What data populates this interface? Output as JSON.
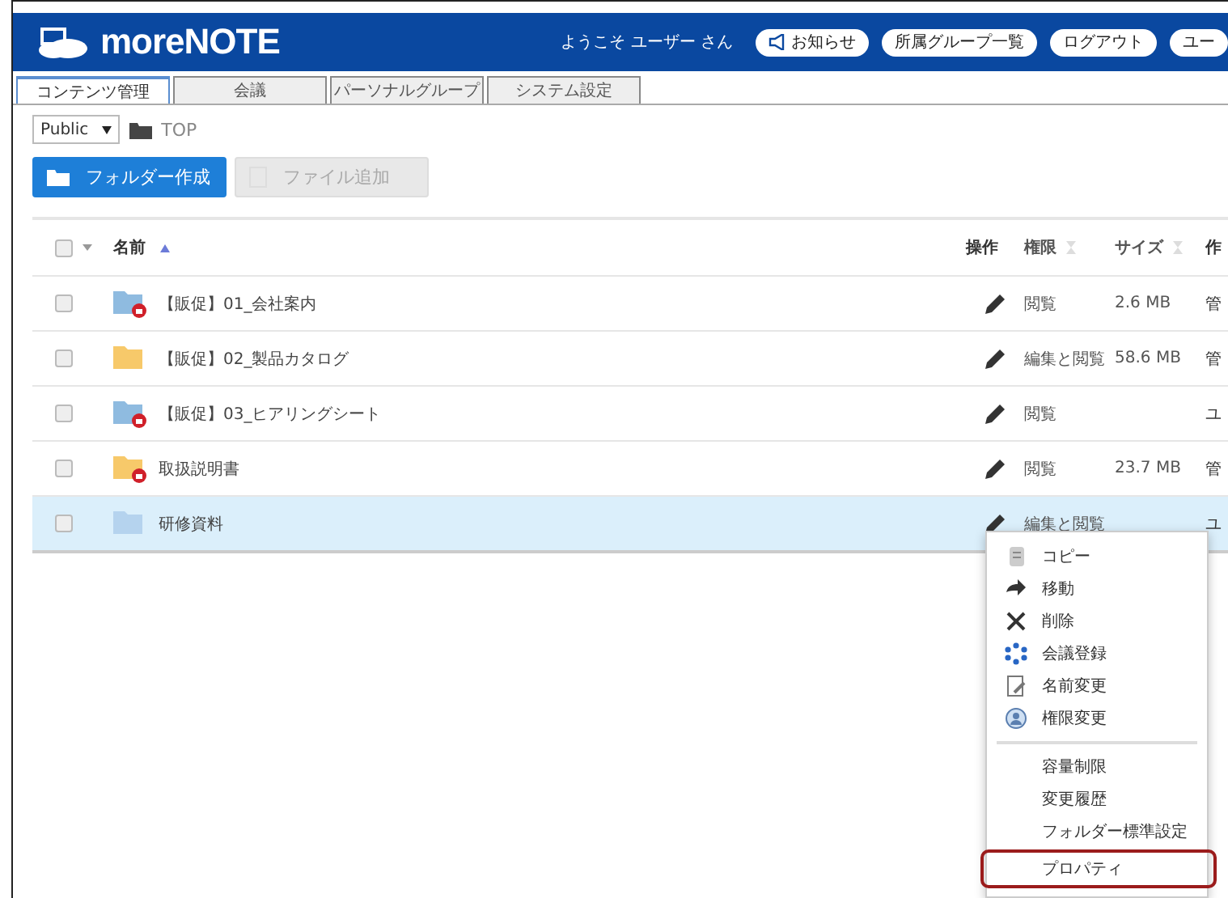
{
  "header": {
    "logo": "moreNOTE",
    "welcome": "ようこそ ユーザー さん",
    "buttons": [
      {
        "label": "お知らせ",
        "kind": "megaphone"
      },
      {
        "label": "所属グループ一覧",
        "kind": "plain"
      },
      {
        "label": "ログアウト",
        "kind": "plain"
      },
      {
        "label": "ユー",
        "kind": "plain"
      }
    ]
  },
  "tabs": [
    {
      "label": "コンテンツ管理",
      "selected": true
    },
    {
      "label": "会議",
      "selected": false
    },
    {
      "label": "パーソナルグループ",
      "selected": false
    },
    {
      "label": "システム設定",
      "selected": false
    }
  ],
  "breadcrumb": {
    "scope": "Public",
    "path": "TOP"
  },
  "actions": [
    {
      "label": "フォルダー作成",
      "disabled": false
    },
    {
      "label": "ファイル追加",
      "disabled": true
    }
  ],
  "table": {
    "select_all_checked": false,
    "columns": [
      {
        "label": "名前",
        "sorted": true
      },
      {
        "label": "操作"
      },
      {
        "label": "権限",
        "sorted": false
      },
      {
        "label": "サイズ",
        "sorted": false
      },
      {
        "label": "作"
      }
    ],
    "rows": [
      {
        "name": "【販促】01_会社案内",
        "color": "#8fbbe0",
        "locked": true,
        "permission": "閲覧",
        "size": "2.6 MB",
        "column_5": "管",
        "selected": false,
        "checked": false
      },
      {
        "name": "【販促】02_製品カタログ",
        "color": "#f7c96a",
        "locked": false,
        "permission": "編集と閲覧",
        "size": "58.6 MB",
        "column_5": "管",
        "selected": false,
        "checked": false
      },
      {
        "name": "【販促】03_ヒアリングシート",
        "color": "#8fbbe0",
        "locked": true,
        "permission": "閲覧",
        "column_5": "ユ",
        "selected": false,
        "checked": false
      },
      {
        "name": "取扱説明書",
        "color": "#f7c96a",
        "locked": true,
        "permission": "閲覧",
        "size": "23.7 MB",
        "column_5": "管",
        "selected": false,
        "checked": false
      },
      {
        "name": "研修資料",
        "color": "#b5d3ee",
        "locked": false,
        "permission": "編集と閲覧",
        "column_5": "ユ",
        "selected": true,
        "checked": false
      }
    ]
  },
  "menu": {
    "groups": [
      {
        "items": [
          {
            "label": "コピー",
            "highlighted": false
          },
          {
            "label": "移動",
            "highlighted": false
          },
          {
            "label": "削除",
            "highlighted": false
          },
          {
            "label": "会議登録",
            "highlighted": false
          },
          {
            "label": "名前変更",
            "highlighted": false
          },
          {
            "label": "権限変更",
            "highlighted": false
          }
        ]
      },
      {
        "items": [
          {
            "label": "容量制限",
            "highlighted": false
          },
          {
            "label": "変更履歴",
            "highlighted": false
          },
          {
            "label": "フォルダー標準設定",
            "highlighted": false
          },
          {
            "label": "プロパティ",
            "highlighted": true
          }
        ]
      }
    ]
  }
}
